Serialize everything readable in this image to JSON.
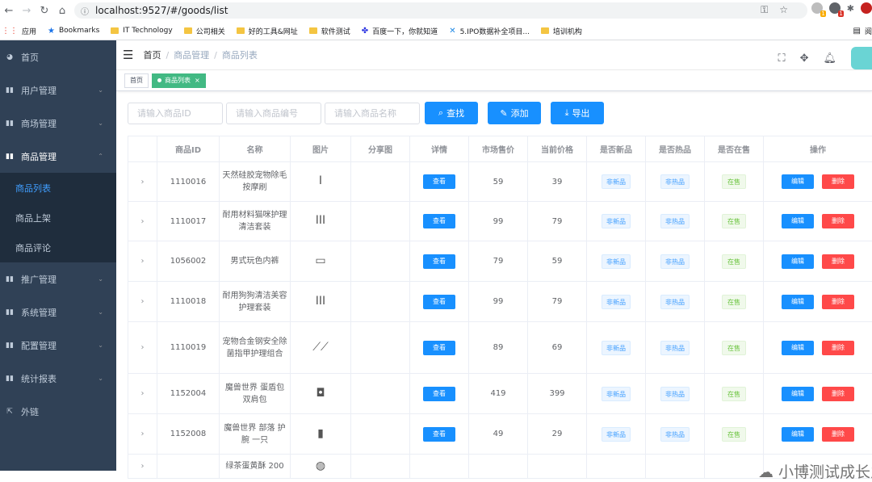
{
  "browser": {
    "url": "localhost:9527/#/goods/list"
  },
  "bookmarks": [
    "应用",
    "Bookmarks",
    "IT Technology",
    "公司相关",
    "好的工具&网址",
    "软件测试",
    "百度一下，你就知道",
    "5.IPO数据补全项目...",
    "培训机构"
  ],
  "bookmark_right": "阅",
  "sidebar": {
    "items": [
      {
        "label": "首页",
        "icon": "dashboard-icon"
      },
      {
        "label": "用户管理",
        "icon": "chart-icon"
      },
      {
        "label": "商场管理",
        "icon": "chart-icon"
      },
      {
        "label": "商品管理",
        "icon": "chart-icon"
      }
    ],
    "sub": [
      "商品列表",
      "商品上架",
      "商品评论"
    ],
    "items2": [
      {
        "label": "推广管理",
        "icon": "chart-icon"
      },
      {
        "label": "系统管理",
        "icon": "chart-icon"
      },
      {
        "label": "配置管理",
        "icon": "chart-icon"
      },
      {
        "label": "统计报表",
        "icon": "chart-icon"
      },
      {
        "label": "外链",
        "icon": "external-link-icon"
      }
    ]
  },
  "breadcrumb": [
    "首页",
    "商品管理",
    "商品列表"
  ],
  "tags": {
    "home": "首页",
    "active": "商品列表"
  },
  "filters": {
    "id": "请输入商品ID",
    "sn": "请输入商品编号",
    "name": "请输入商品名称",
    "search": "查找",
    "add": "添加",
    "export": "导出"
  },
  "table": {
    "headers": [
      "",
      "商品ID",
      "名称",
      "图片",
      "分享图",
      "详情",
      "市场售价",
      "当前价格",
      "是否新品",
      "是否热品",
      "是否在售",
      "操作"
    ],
    "view": "查看",
    "edit": "编辑",
    "del": "删除",
    "rows": [
      {
        "id": "1110016",
        "name": "天然硅胶宠物除毛按摩刷",
        "market": "59",
        "price": "39",
        "isnew": "非新品",
        "ishot": "非热品",
        "onsale": "在售"
      },
      {
        "id": "1110017",
        "name": "耐用材料猫咪护理清洁套装",
        "market": "99",
        "price": "79",
        "isnew": "非新品",
        "ishot": "非热品",
        "onsale": "在售"
      },
      {
        "id": "1056002",
        "name": "男式玩色内裤",
        "market": "79",
        "price": "59",
        "isnew": "非新品",
        "ishot": "非热品",
        "onsale": "在售"
      },
      {
        "id": "1110018",
        "name": "耐用狗狗清洁美容护理套装",
        "market": "99",
        "price": "79",
        "isnew": "非新品",
        "ishot": "非热品",
        "onsale": "在售"
      },
      {
        "id": "1110019",
        "name": "宠物合金钢安全除菌指甲护理组合",
        "market": "89",
        "price": "69",
        "isnew": "非新品",
        "ishot": "非热品",
        "onsale": "在售"
      },
      {
        "id": "1152004",
        "name": "魔兽世界 蛋盾包 双肩包",
        "market": "419",
        "price": "399",
        "isnew": "非新品",
        "ishot": "非热品",
        "onsale": "在售"
      },
      {
        "id": "1152008",
        "name": "魔兽世界 部落 护腕 一只",
        "market": "49",
        "price": "29",
        "isnew": "非新品",
        "ishot": "非热品",
        "onsale": "在售"
      },
      {
        "id": "",
        "name": "绿茶蛋黄酥 200",
        "market": "",
        "price": "",
        "isnew": "",
        "ishot": "",
        "onsale": ""
      }
    ]
  },
  "watermark": "小博测试成长之路"
}
